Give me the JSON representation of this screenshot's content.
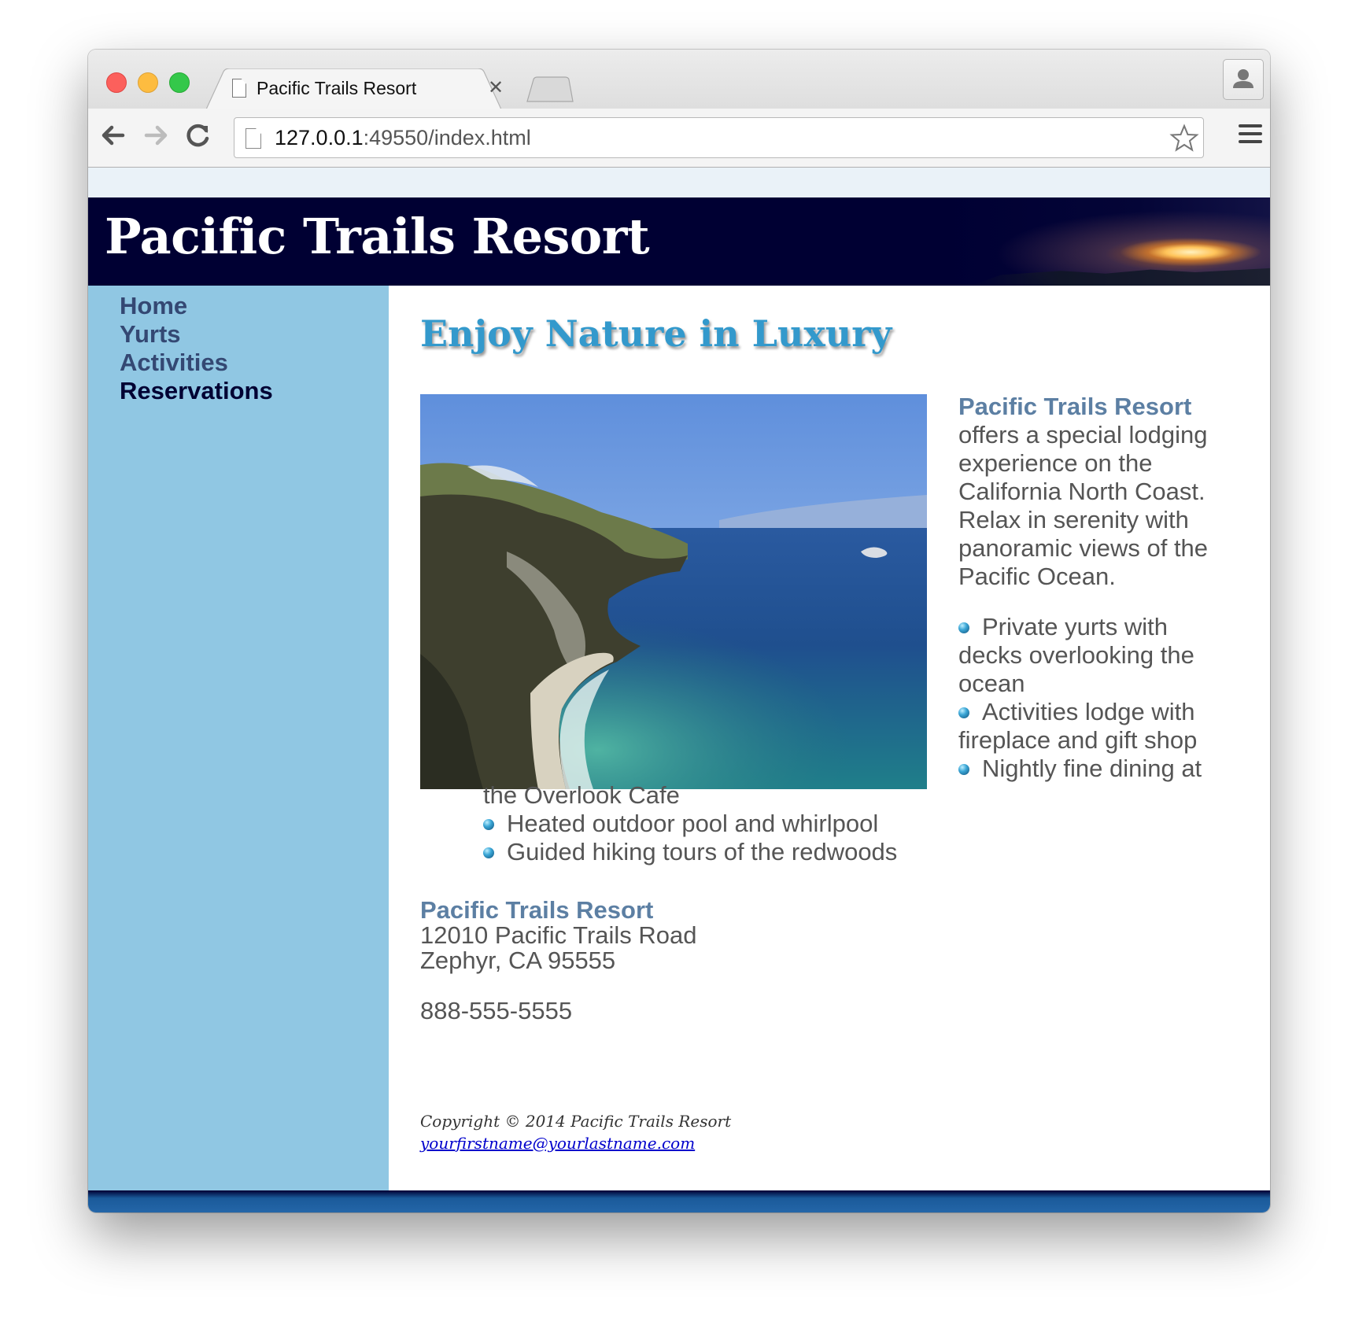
{
  "browser": {
    "tab_title": "Pacific Trails Resort",
    "url_host": "127.0.0.1",
    "url_rest": ":49550/index.html"
  },
  "site": {
    "title": "Pacific Trails Resort",
    "nav": [
      {
        "label": "Home"
      },
      {
        "label": "Yurts"
      },
      {
        "label": "Activities"
      },
      {
        "label": "Reservations"
      }
    ],
    "heading": "Enjoy Nature in Luxury",
    "intro_name": "Pacific Trails Resort",
    "intro_lines": [
      "offers a special lodging",
      "experience on the",
      "California North Coast.",
      "Relax in serenity with",
      "panoramic views of the",
      "Pacific Ocean."
    ],
    "features_right": [
      [
        "Private yurts with",
        "decks overlooking the",
        "ocean"
      ],
      [
        "Activities lodge with",
        "fireplace and gift shop"
      ],
      [
        "Nightly fine dining at"
      ]
    ],
    "feature_wrap": "the Overlook Cafe",
    "features_under": [
      "Heated outdoor pool and whirlpool",
      "Guided hiking tours of the redwoods"
    ],
    "address": {
      "name": "Pacific Trails Resort",
      "street": "12010 Pacific Trails Road",
      "city": "Zephyr, CA 95555",
      "phone": "888-555-5555"
    },
    "footer": {
      "copyright": "Copyright © 2014 Pacific Trails Resort",
      "email": "yourfirstname@yourlastname.com"
    }
  },
  "colors": {
    "header_bg": "#000033",
    "sidebar_bg": "#90c7e3",
    "heading": "#3399cc",
    "nav_link": "#344873",
    "resort_name": "#5c7fa3"
  }
}
